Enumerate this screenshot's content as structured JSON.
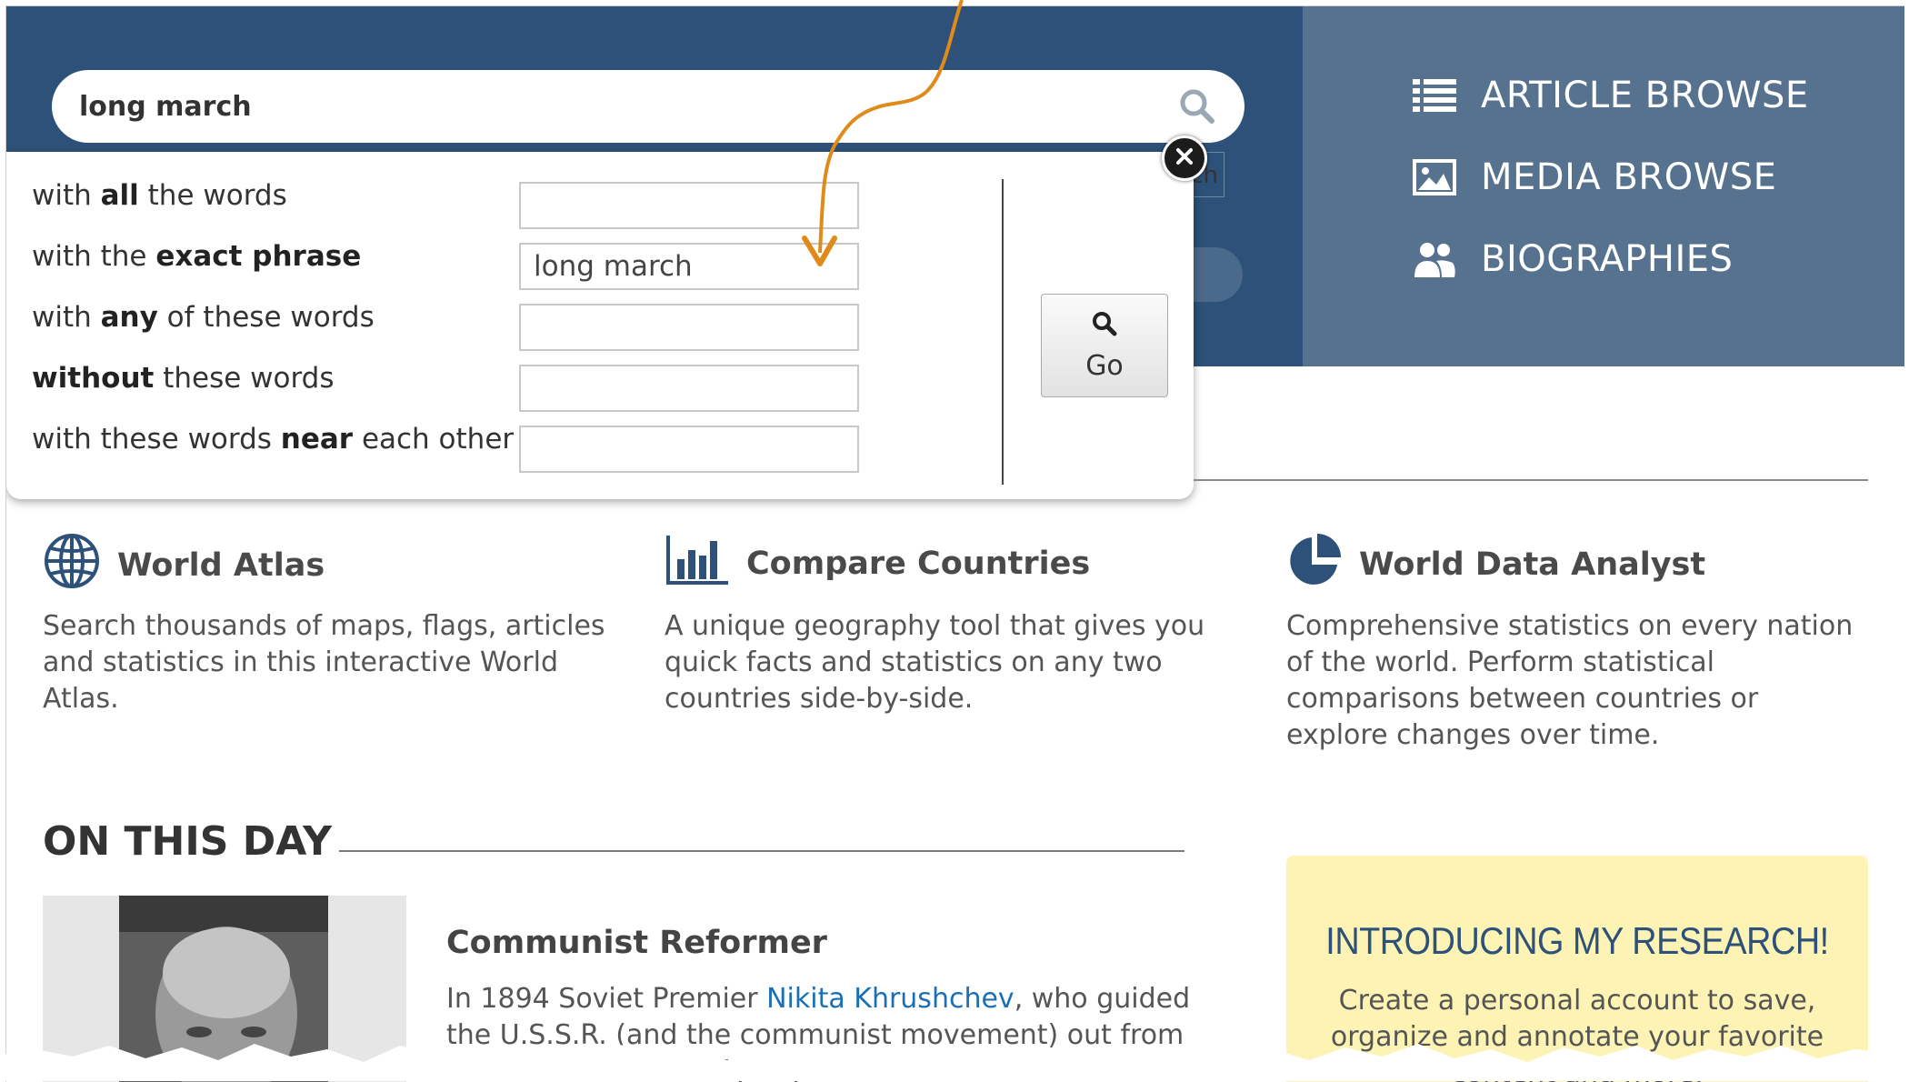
{
  "search": {
    "query": "long march"
  },
  "hero_clipped_button": "ch",
  "nav": {
    "items": [
      {
        "label": "ARTICLE BROWSE",
        "icon": "list-icon"
      },
      {
        "label": "MEDIA BROWSE",
        "icon": "image-icon"
      },
      {
        "label": "BIOGRAPHIES",
        "icon": "people-icon"
      }
    ]
  },
  "advanced_search": {
    "rows": [
      {
        "pre": "with ",
        "bold": "all",
        "post": " the words",
        "value": ""
      },
      {
        "pre": "with the ",
        "bold": "exact phrase",
        "post": "",
        "value": "long march"
      },
      {
        "pre": "with ",
        "bold": "any",
        "post": " of these words",
        "value": ""
      },
      {
        "pre": "",
        "bold": "without",
        "post": " these words",
        "value": ""
      },
      {
        "pre": "with these words ",
        "bold": "near",
        "post": " each other",
        "value": ""
      }
    ],
    "go_label": "Go"
  },
  "features": [
    {
      "title": "World Atlas",
      "icon": "globe-icon",
      "desc": "Search thousands of maps, flags, articles and statistics in this interactive World Atlas."
    },
    {
      "title": "Compare Countries",
      "icon": "bar-chart-icon",
      "desc": "A unique geography tool that gives you quick facts and statistics on any two countries side-by-side."
    },
    {
      "title": "World Data Analyst",
      "icon": "pie-chart-icon",
      "desc": "Comprehensive statistics on every nation of the world. Perform statistical comparisons between countries or explore changes over time."
    }
  ],
  "on_this_day": {
    "title": "ON THIS DAY",
    "headline": "Communist Reformer",
    "text_before": "In 1894 Soviet Premier ",
    "link": "Nikita Khrushchev",
    "text_after": ", who guided the U.S.S.R. (and the communist movement) out from under the shadow of Joseph Stalin and into a new era..."
  },
  "research": {
    "title": "INTRODUCING MY RESEARCH!",
    "text": "Create a personal account to save, organize and annotate your favorite content and more."
  },
  "colors": {
    "header": "#2d5178",
    "nav": "#56728f",
    "accent_arrow": "#e08a1a",
    "link": "#1a6fb5",
    "research_bg": "#fdf3b5"
  }
}
